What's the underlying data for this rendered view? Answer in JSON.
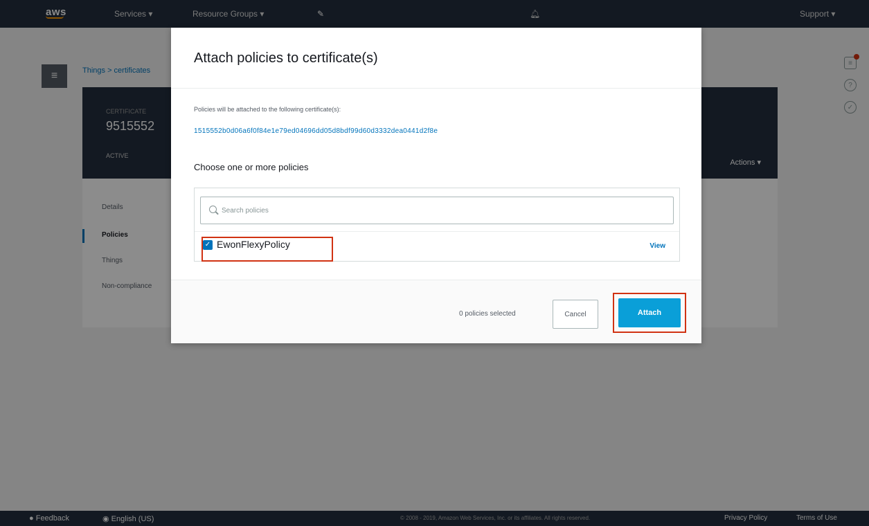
{
  "nav": {
    "logo": "aws",
    "services": "Services",
    "resource_groups": "Resource Groups",
    "user": "Support"
  },
  "background": {
    "breadcrumb": "Things > certificates",
    "cert_type": "CERTIFICATE",
    "cert_id": "9515552",
    "cert_status": "ACTIVE",
    "actions": "Actions",
    "side_nav": [
      "Details",
      "Policies",
      "Things",
      "Non-compliance"
    ]
  },
  "modal": {
    "title": "Attach policies to certificate(s)",
    "info_label": "Policies will be attached to the following certificate(s):",
    "certificate_hash": "1515552b0d06a6f0f84e1e79ed04696dd05d8bdf99d60d3332dea0441d2f8e",
    "choose_label": "Choose one or more policies",
    "search_placeholder": "Search policies",
    "policies": [
      {
        "name": "EwonFlexyPolicy",
        "checked": true,
        "view_label": "View"
      }
    ],
    "selected_count": "0 policies selected",
    "cancel_label": "Cancel",
    "attach_label": "Attach"
  },
  "footer": {
    "feedback": "Feedback",
    "language": "English (US)",
    "copyright": "© 2008 - 2019, Amazon Web Services, Inc. or its affiliates. All rights reserved.",
    "privacy": "Privacy Policy",
    "terms": "Terms of Use"
  },
  "colors": {
    "nav_bg": "#232f3e",
    "primary_button": "#0a9fd8",
    "highlight": "#d13212",
    "link": "#0073bb"
  }
}
